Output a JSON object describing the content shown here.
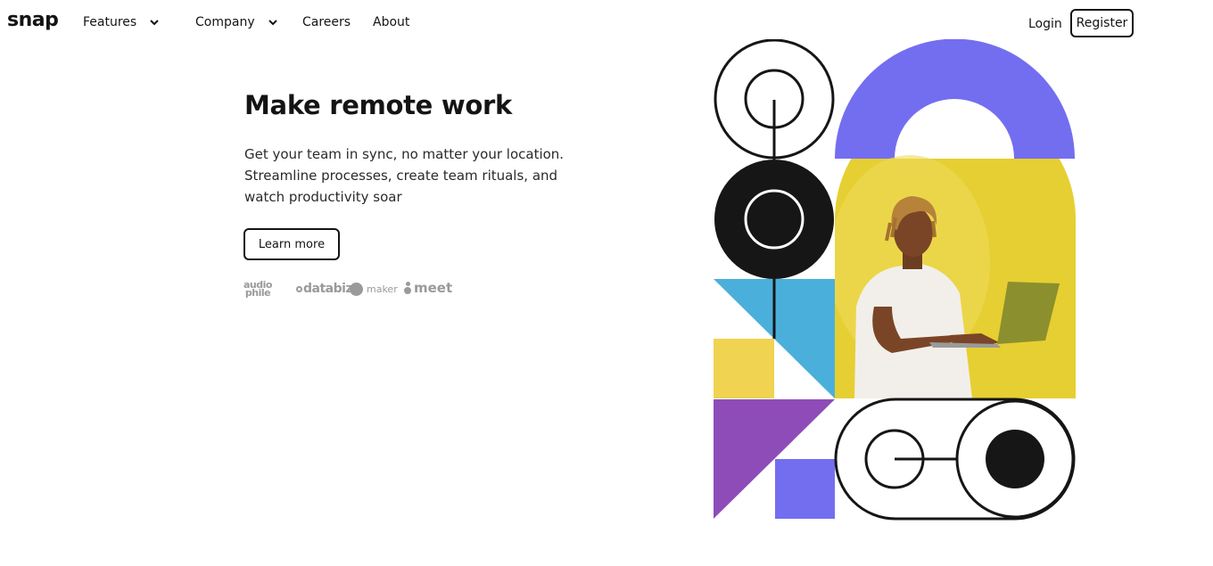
{
  "brand": {
    "logo": "snap"
  },
  "nav": {
    "features_label": "Features",
    "company_label": "Company",
    "careers_label": "Careers",
    "about_label": "About"
  },
  "auth": {
    "login_label": "Login",
    "register_label": "Register"
  },
  "hero": {
    "title": "Make remote work",
    "description_lines": [
      "Get your team in sync, no matter your location.",
      "Streamline processes, create team rituals, and",
      "watch productivity soar"
    ],
    "cta_label": "Learn more"
  },
  "clients": {
    "audiophile_top": "audio",
    "audiophile_bottom": "phile",
    "databiz": "databiz",
    "maker": "maker",
    "meet": "meet"
  },
  "colors": {
    "text": "#141414",
    "purple": "#736EF0",
    "yellow": "#E6CF32",
    "blue": "#4BAFDB",
    "violet": "#8E4CB8",
    "dark": "#161616"
  },
  "icons": {
    "chevron": "chevron-down-icon"
  },
  "illustration": {
    "subject": "person-with-laptop-photo"
  }
}
